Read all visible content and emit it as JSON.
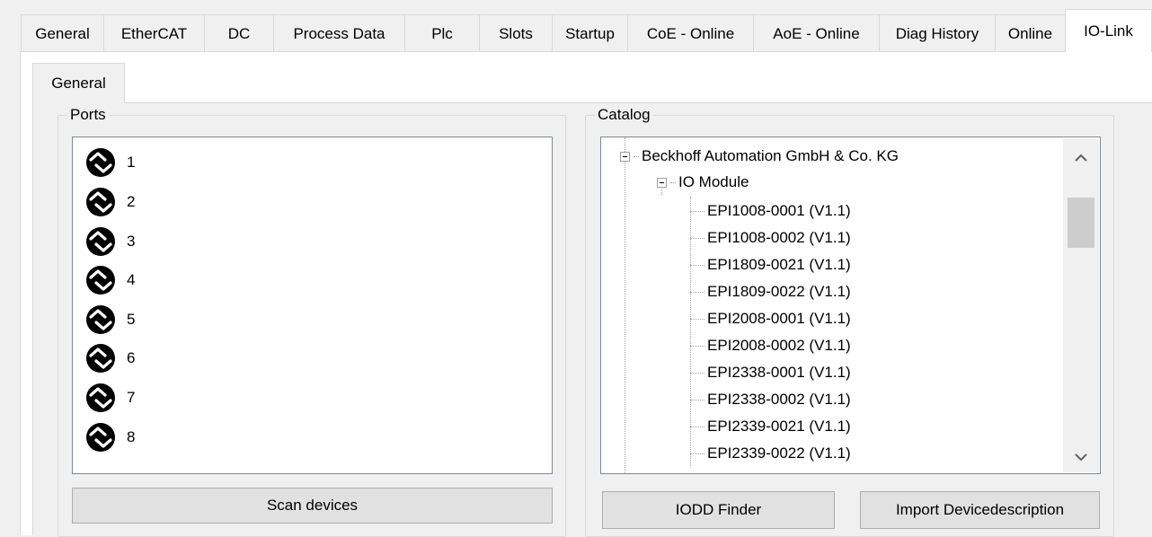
{
  "tabs": [
    {
      "label": "General"
    },
    {
      "label": "EtherCAT"
    },
    {
      "label": "DC"
    },
    {
      "label": "Process Data"
    },
    {
      "label": "Plc"
    },
    {
      "label": "Slots"
    },
    {
      "label": "Startup"
    },
    {
      "label": "CoE - Online"
    },
    {
      "label": "AoE - Online"
    },
    {
      "label": "Diag History"
    },
    {
      "label": "Online"
    },
    {
      "label": "IO-Link"
    }
  ],
  "active_tab": "IO-Link",
  "inner_tab": {
    "label": "General"
  },
  "ports": {
    "title": "Ports",
    "items": [
      {
        "label": "1"
      },
      {
        "label": "2"
      },
      {
        "label": "3"
      },
      {
        "label": "4"
      },
      {
        "label": "5"
      },
      {
        "label": "6"
      },
      {
        "label": "7"
      },
      {
        "label": "8"
      }
    ],
    "icon": "port-connector-icon",
    "scan_button": "Scan devices"
  },
  "catalog": {
    "title": "Catalog",
    "vendor": "Beckhoff Automation GmbH & Co. KG",
    "group": "IO Module",
    "items": [
      {
        "label": "EPI1008-0001 (V1.1)"
      },
      {
        "label": "EPI1008-0002 (V1.1)"
      },
      {
        "label": "EPI1809-0021 (V1.1)"
      },
      {
        "label": "EPI1809-0022 (V1.1)"
      },
      {
        "label": "EPI2008-0001 (V1.1)"
      },
      {
        "label": "EPI2008-0002 (V1.1)"
      },
      {
        "label": "EPI2338-0001 (V1.1)"
      },
      {
        "label": "EPI2338-0002 (V1.1)"
      },
      {
        "label": "EPI2339-0021 (V1.1)"
      },
      {
        "label": "EPI2339-0022 (V1.1)"
      }
    ],
    "iodd_button": "IODD Finder",
    "import_button": "Import Devicedescription",
    "scroll_up": "^",
    "scroll_down": "v"
  },
  "colors": {
    "window_bg": "#f0f0f0",
    "list_bg": "#ffffff",
    "button_bg": "#e1e1e1",
    "icon_fill": "#000000"
  }
}
